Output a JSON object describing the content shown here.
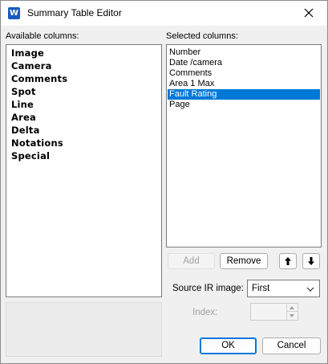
{
  "window": {
    "title": "Summary Table Editor",
    "app_icon_letter": "W",
    "accent_color": "#0078d7"
  },
  "available": {
    "label": "Available columns:",
    "items": [
      "Image",
      "Camera",
      "Comments",
      "Spot",
      "Line",
      "Area",
      "Delta",
      "Notations",
      "Special"
    ]
  },
  "selected": {
    "label": "Selected columns:",
    "items": [
      "Number",
      "Date /camera",
      "Comments",
      "Area 1 Max",
      "Fault Rating",
      "Page"
    ],
    "selected_item": "Fault Rating"
  },
  "buttons": {
    "add": "Add",
    "remove": "Remove",
    "move_up_icon": "arrow-up-icon",
    "move_down_icon": "arrow-down-icon",
    "ok": "OK",
    "cancel": "Cancel"
  },
  "source_ir": {
    "label": "Source IR image:",
    "value": "First"
  },
  "index": {
    "label": "Index:",
    "value": ""
  }
}
